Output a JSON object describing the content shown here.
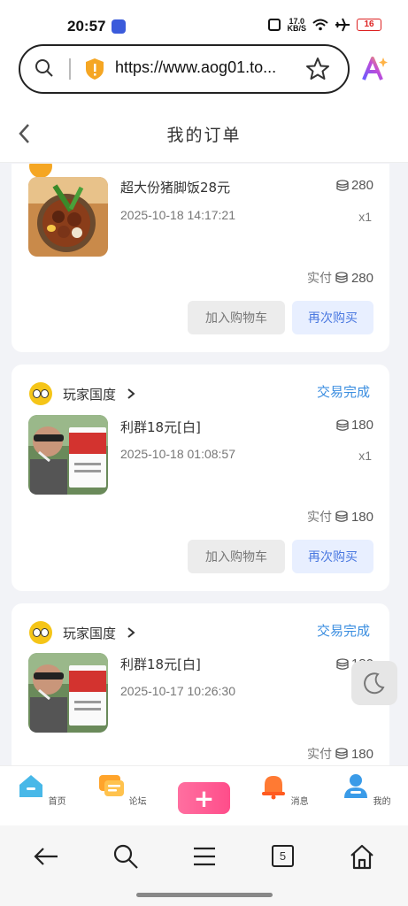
{
  "status_bar": {
    "time": "20:57",
    "net_speed_value": "17.0",
    "net_speed_unit": "KB/S",
    "battery": "16"
  },
  "browser": {
    "url": "https://www.aog01.to...",
    "tab_count": "5"
  },
  "page": {
    "title": "我的订单"
  },
  "orders": [
    {
      "product": "超大份猪脚饭28元",
      "price": "280",
      "date": "2025-10-18 14:17:21",
      "qty": "x1",
      "paid_label": "实付",
      "paid": "280",
      "btn_cart": "加入购物车",
      "btn_again": "再次购买"
    },
    {
      "shop": "玩家国度",
      "status": "交易完成",
      "product": "利群18元[白]",
      "price": "180",
      "date": "2025-10-18 01:08:57",
      "qty": "x1",
      "paid_label": "实付",
      "paid": "180",
      "btn_cart": "加入购物车",
      "btn_again": "再次购买"
    },
    {
      "shop": "玩家国度",
      "status": "交易完成",
      "product": "利群18元[白]",
      "price": "180",
      "date": "2025-10-17 10:26:30",
      "paid_label": "实付",
      "paid": "180"
    }
  ],
  "tabs": {
    "home": "首页",
    "forum": "论坛",
    "notify": "消息",
    "mine": "我的"
  },
  "icons": {
    "status": [
      "app-badge-icon",
      "nfc-icon",
      "wifi-icon",
      "airplane-icon",
      "battery-icon"
    ],
    "browser": [
      "search-icon",
      "shield-warning-icon",
      "star-icon",
      "ai-icon"
    ],
    "page": [
      "chevron-left-icon",
      "coin-stack-icon",
      "chevron-right-icon",
      "moon-icon",
      "plus-icon"
    ],
    "nav": [
      "arrow-left-icon",
      "search-icon",
      "menu-icon",
      "tabs-icon",
      "home-icon"
    ]
  },
  "colors": {
    "accent": "#3b8ee0",
    "buy_again": "#4a78e0",
    "publish": "#ff4d8a",
    "battery": "#dd2222"
  }
}
